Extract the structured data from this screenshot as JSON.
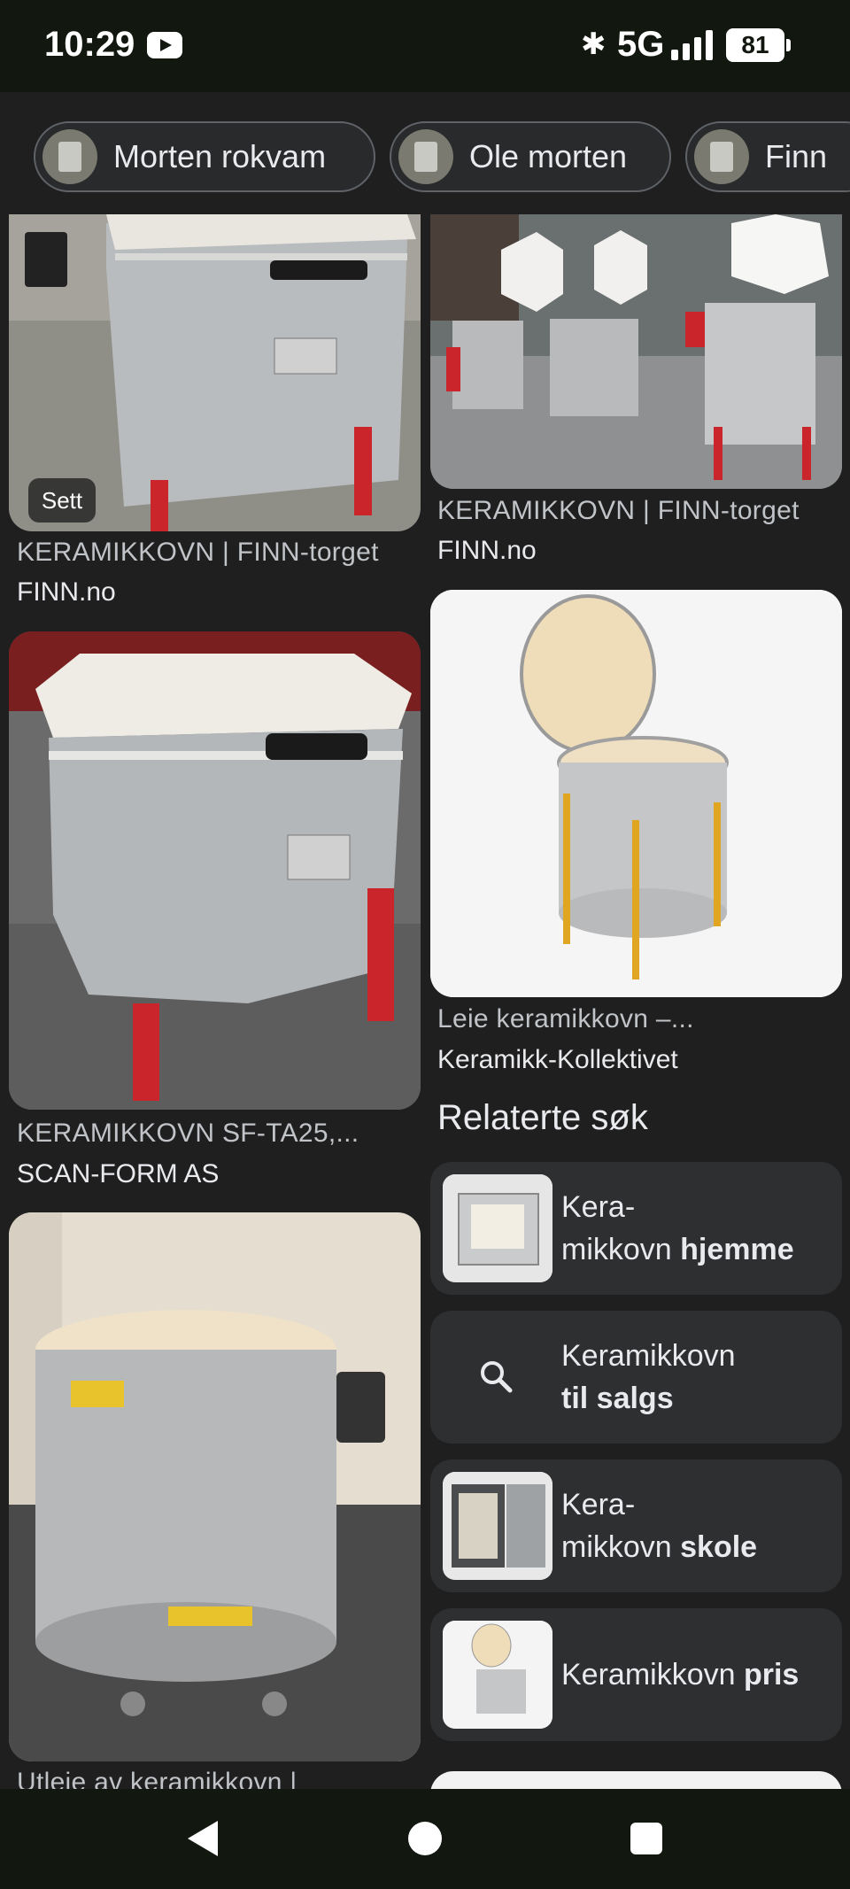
{
  "status_bar": {
    "time": "10:29",
    "network": "5G",
    "battery": "81"
  },
  "chips": [
    {
      "label": "Morten rokvam"
    },
    {
      "label": "Ole morten"
    },
    {
      "label": "Finn"
    }
  ],
  "results": [
    {
      "caption": "KERAMIKKOVN | FINN-torget",
      "source": "FINN.no",
      "badge": "Sett"
    },
    {
      "caption": "KERAMIKKOVN | FINN-torget",
      "source": "FINN.no"
    },
    {
      "caption": "KERAMIKKOVN SF-TA25,...",
      "source": "SCAN-FORM AS"
    },
    {
      "caption": "Leie keramikkovn –...",
      "source": "Keramikk-Kollektivet"
    },
    {
      "caption": "Utleie av keramikkovn |"
    }
  ],
  "related": {
    "title": "Relaterte søk",
    "items": [
      {
        "line1": "Kera-",
        "line2_plain": "mikkovn ",
        "line2_bold": "hjemme",
        "icon": "kiln-thumbnail"
      },
      {
        "line1": "Keramikkovn",
        "line2_plain": "",
        "line2_bold": "til salgs",
        "icon": "search-icon"
      },
      {
        "line1": "Kera-",
        "line2_plain": "mikkovn ",
        "line2_bold": "skole",
        "icon": "kiln-thumbnail"
      },
      {
        "line1": "Keramikkovn ",
        "line2_bold": "pris",
        "icon": "kiln-thumbnail"
      }
    ]
  }
}
